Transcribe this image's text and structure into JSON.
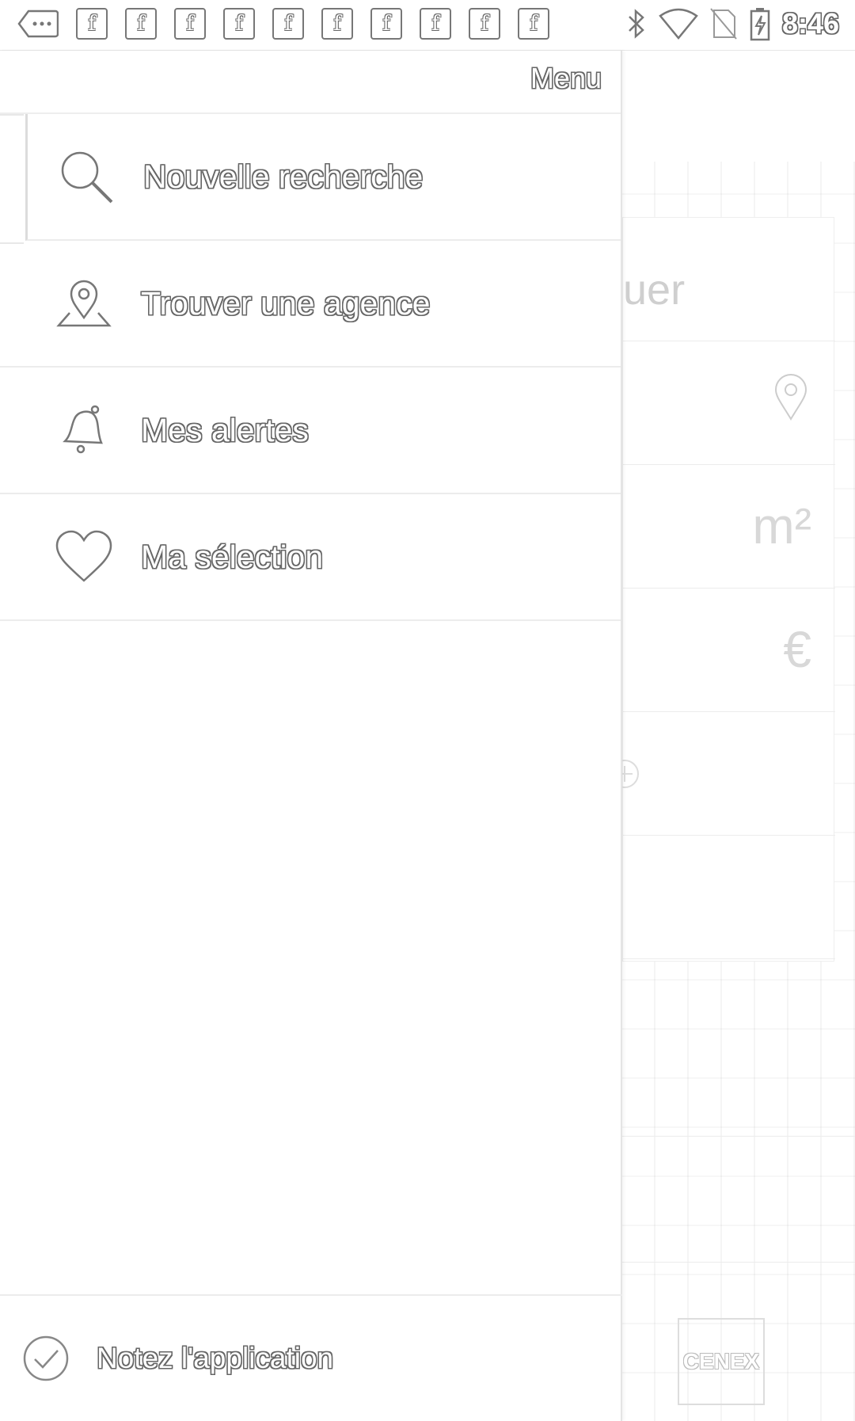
{
  "status_bar": {
    "notification_icons": [
      "f",
      "f",
      "f",
      "f",
      "f",
      "f",
      "f",
      "f",
      "f",
      "f"
    ],
    "time": "8:46",
    "icons": [
      "bluetooth-icon",
      "wifi-icon",
      "no-sim-icon",
      "battery-charging-icon"
    ]
  },
  "drawer": {
    "title": "Menu",
    "items": [
      {
        "label": "Nouvelle recherche",
        "icon": "search-icon"
      },
      {
        "label": "Trouver une agence",
        "icon": "map-pin-icon"
      },
      {
        "label": "Mes alertes",
        "icon": "bell-icon"
      },
      {
        "label": "Ma sélection",
        "icon": "heart-icon"
      }
    ],
    "rate": {
      "label": "Notez l'application",
      "icon": "check-circle-icon"
    }
  },
  "background": {
    "search_fragment": "uer",
    "area_unit": "m²",
    "price_unit": "€",
    "logo_text": "CENEX"
  }
}
